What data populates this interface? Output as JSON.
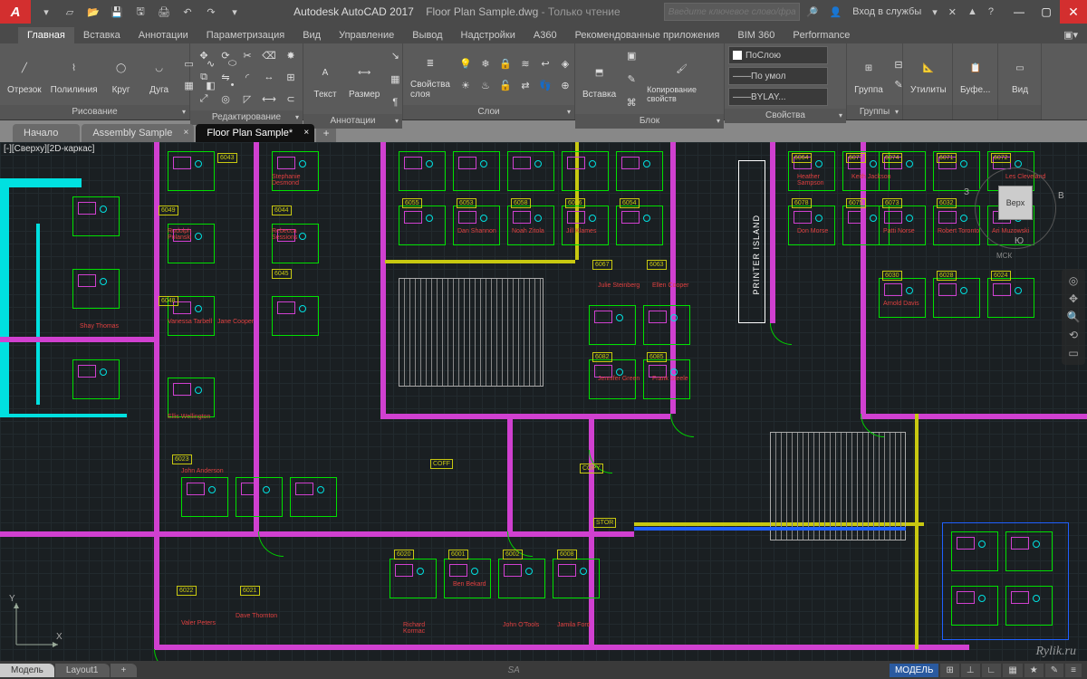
{
  "title": {
    "app": "Autodesk AutoCAD 2017",
    "file": "Floor Plan Sample.dwg",
    "readonly": "- Только чтение"
  },
  "search": {
    "placeholder": "Введите ключевое слово/фразу"
  },
  "signin": "Вход в службы",
  "ribbon_tabs": [
    "Главная",
    "Вставка",
    "Аннотации",
    "Параметризация",
    "Вид",
    "Управление",
    "Вывод",
    "Надстройки",
    "A360",
    "Рекомендованные приложения",
    "BIM 360",
    "Performance"
  ],
  "panels": {
    "draw": {
      "title": "Рисование",
      "btns": {
        "line": "Отрезок",
        "polyline": "Полилиния",
        "circle": "Круг",
        "arc": "Дуга"
      }
    },
    "modify": {
      "title": "Редактирование"
    },
    "annot": {
      "title": "Аннотации",
      "btns": {
        "text": "Текст",
        "dim": "Размер"
      }
    },
    "layers": {
      "title": "Слои",
      "btn": "Свойства слоя"
    },
    "block": {
      "title": "Блок",
      "btns": {
        "insert": "Вставка",
        "copy": "Копирование свойств"
      }
    },
    "properties": {
      "title": "Свойства",
      "combo1": "ПоСлою",
      "combo2": "По умол",
      "combo3": "BYLAY..."
    },
    "groups": {
      "title": "Группы",
      "btn": "Группа"
    },
    "util": {
      "title": " ",
      "btn": "Утилиты"
    },
    "clip": {
      "title": " ",
      "btn": "Буфе..."
    },
    "view": {
      "title": " ",
      "btn": "Вид"
    }
  },
  "doc_tabs": [
    "Начало",
    "Assembly Sample",
    "Floor Plan Sample*"
  ],
  "viewport_label": "[-][Сверху][2D-каркас]",
  "viewcube": {
    "top": "Верх",
    "n": "З",
    "s": "Ю",
    "e": "В",
    "wcs": "МСК"
  },
  "printer_island": "PRINTER ISLAND",
  "copy_label": "COPY",
  "stor_label": "STOR",
  "coff_label": "COFF",
  "room_tags": [
    "6043",
    "6049",
    "6044",
    "6048",
    "6045",
    "6055",
    "6053",
    "6058",
    "6056",
    "6054",
    "6067",
    "6063",
    "6082",
    "6085",
    "6064",
    "6077",
    "6078",
    "6075",
    "6074",
    "6071",
    "6072",
    "6073",
    "6032",
    "6030",
    "6028",
    "6024",
    "6023",
    "6022",
    "6021",
    "6020",
    "6001",
    "6002",
    "6008"
  ],
  "names": [
    "Rudolph Polanski",
    "Rebecca Sessions",
    "Vanessa Tarbell",
    "Stephanie Desmond",
    "Jane Cooper",
    "Ellis Wellington",
    "John Anderson",
    "Shay Thomas",
    "Dave Thornton",
    "Valer Peters",
    "Dan Shannon",
    "Noah Zitola",
    "Jill Klames",
    "Julie Steinberg",
    "Ellen Cooper",
    "Jennifer Green",
    "Frank Steele",
    "Heather Sampson",
    "Keith Jackson",
    "Don Morse",
    "Patti Norse",
    "Robert Toronto",
    "Arnold Davis",
    "Ari Muzowski",
    "Les Cleveland",
    "Ben Bekard",
    "Richard Kormac",
    "John O'Tools",
    "Jamila Ford"
  ],
  "model_bar": {
    "model": "Модель",
    "layout1": "Layout1",
    "cmd": "SA",
    "status": [
      "МОДЕЛЬ",
      "⊞",
      "⊥",
      "∟",
      "▦",
      "★",
      "✎",
      "≡"
    ]
  },
  "watermark": "Rylik.ru",
  "axes": {
    "x": "X",
    "y": "Y"
  }
}
